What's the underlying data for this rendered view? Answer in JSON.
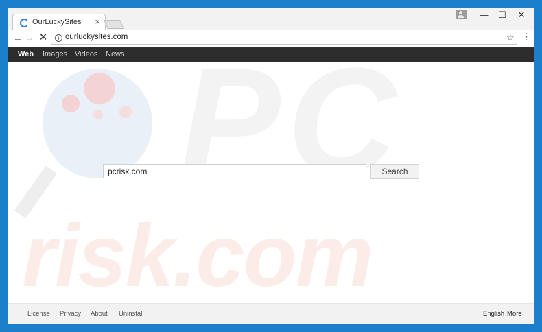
{
  "browser": {
    "tab": {
      "title": "OurLuckySites",
      "close": "×"
    },
    "window_controls": {
      "minimize": "—",
      "maximize": "☐",
      "close": "✕"
    },
    "nav": {
      "back": "←",
      "forward": "→",
      "stop": "✕"
    },
    "address_bar": {
      "url": "ourluckysites.com",
      "info": "i"
    },
    "icons": {
      "star": "☆",
      "menu": "⋮"
    }
  },
  "page": {
    "navbar": {
      "items": [
        "Web",
        "Images",
        "Videos",
        "News"
      ],
      "active": "Web"
    },
    "watermark": {
      "text_top": "PC",
      "text_bottom": "risk.com"
    },
    "search": {
      "value": "pcrisk.com",
      "button_label": "Search"
    },
    "footer": {
      "left_links": [
        "License",
        "Privacy",
        "About",
        "Uninstall"
      ],
      "right_links": [
        "English",
        "More"
      ]
    }
  },
  "colors": {
    "desktop": "#1c7fcc",
    "navbar": "#2d2d2d",
    "spinner": "#3d7ce0"
  }
}
